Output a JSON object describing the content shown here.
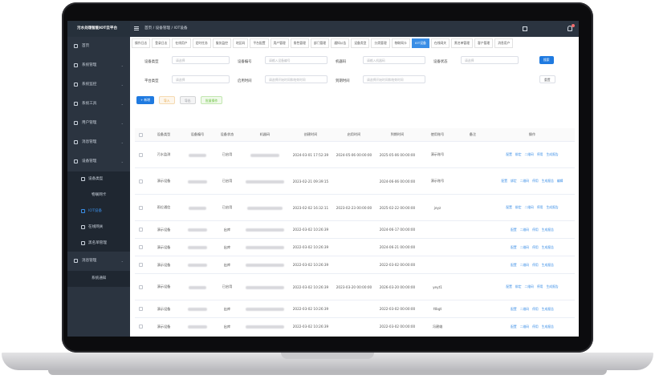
{
  "app": {
    "title": "污水处理智能IOT云平台"
  },
  "sidebar": {
    "items": [
      {
        "label": "首页",
        "icon": "home-icon",
        "type": "top"
      },
      {
        "label": "系统管理",
        "icon": "gear-icon",
        "type": "top"
      },
      {
        "label": "系统监控",
        "icon": "monitor-icon",
        "type": "top"
      },
      {
        "label": "系统工具",
        "icon": "tool-icon",
        "type": "top"
      },
      {
        "label": "用户管理",
        "icon": "user-icon",
        "type": "top"
      },
      {
        "label": "消息管理",
        "icon": "message-icon",
        "type": "top"
      },
      {
        "label": "设备管理",
        "icon": "device-icon",
        "type": "top"
      },
      {
        "label": "设备类型",
        "icon": "device-type-icon",
        "type": "sub"
      },
      {
        "label": "物联网卡",
        "icon": "",
        "type": "plain"
      },
      {
        "label": "IOT设备",
        "icon": "iot-icon",
        "type": "sub",
        "active": true
      },
      {
        "label": "在线网关",
        "icon": "gateway-icon",
        "type": "sub"
      },
      {
        "label": "黑名单管理",
        "icon": "blacklist-icon",
        "type": "sub"
      },
      {
        "label": "消息管理",
        "icon": "message-icon",
        "type": "top"
      },
      {
        "label": "系统通知",
        "icon": "",
        "type": "plain"
      }
    ]
  },
  "topbar": {
    "breadcrumb": "首页  /  设备管理  /  IOT设备"
  },
  "tabs": [
    "操作日志",
    "登录日志",
    "在线用户",
    "定时任务",
    "服务监控",
    "地区码",
    "平台配置",
    "用户管理",
    "角色管理",
    "部门管理",
    "通知公告",
    "设备类型",
    "分类管理",
    "物联网卡",
    "IOT设备",
    "在线网关",
    "黑名单管理",
    "客户管理",
    "消息用户"
  ],
  "active_tab": "IOT设备",
  "filters": {
    "device_type_label": "设备类型",
    "device_type_placeholder": "请选择",
    "device_no_label": "设备编号",
    "device_no_placeholder": "请输入设备编号",
    "machine_code_label": "机器码",
    "machine_code_placeholder": "请输入机器码",
    "device_status_label": "设备状态",
    "device_status_placeholder": "请选择",
    "platform_type_label": "平台类型",
    "platform_type_placeholder": "请选择",
    "enable_time_label": "启用时间",
    "enable_time_placeholder": "请选择开始时间和结束时间",
    "expire_time_label": "到期时间",
    "expire_time_placeholder": "请选择开始时间和结束时间"
  },
  "buttons": {
    "search": "搜索",
    "reset": "重置",
    "add": "+ 新增",
    "import": "导入",
    "export": "导出",
    "batch": "批量操作"
  },
  "table": {
    "headers": [
      "设备类型",
      "设备编号",
      "设备状态",
      "机器码",
      "创建时间",
      "启用时间",
      "到期时间",
      "使用账号",
      "备注",
      "操作"
    ],
    "rows": [
      {
        "type": "污水监测",
        "status": "已启用",
        "created": "2024-03-01 17:52:39",
        "enabled": "2024-05-06 00:00:00",
        "expire": "2025-05-06 00:00:00",
        "account": "演示账号",
        "note": "",
        "ops": [
          "配置",
          "绑定",
          "二维码",
          "停用",
          "生成报告"
        ]
      },
      {
        "type": "演示设备",
        "status": "已启用",
        "created": "2023-02-21 09:39:15",
        "enabled": "",
        "expire": "2024-06-06 00:00:00",
        "account": "演示账号",
        "note": "",
        "ops": [
          "配置",
          "绑定",
          "二维码",
          "停用",
          "生成报告",
          "编辑"
        ]
      },
      {
        "type": "雨位通信",
        "status": "已启用",
        "created": "2023-02-02 16:32:11",
        "enabled": "2023-02-23 00:00:00",
        "expire": "2025-02-22 00:00:00",
        "account": "jeyz",
        "note": "",
        "ops": [
          "配置",
          "绑定",
          "二维码",
          "停用",
          "生成报告"
        ]
      },
      {
        "type": "演示设备",
        "status": "出库",
        "created": "2022-03-02 10:26:39",
        "enabled": "",
        "expire": "2024-06-17 00:00:00",
        "account": "",
        "note": "",
        "ops": [
          "配置",
          "二维码",
          "停用",
          "生成报告"
        ]
      },
      {
        "type": "演示设备",
        "status": "出库",
        "created": "2022-03-02 10:26:39",
        "enabled": "",
        "expire": "2024-06-21 00:00:00",
        "account": "",
        "note": "",
        "ops": [
          "配置",
          "二维码",
          "停用",
          "生成报告"
        ]
      },
      {
        "type": "演示设备",
        "status": "出库",
        "created": "2022-03-02 10:26:39",
        "enabled": "",
        "expire": "2022-03-02 00:00:00",
        "account": "",
        "note": "",
        "ops": [
          "配置",
          "二维码",
          "停用",
          "生成报告"
        ]
      },
      {
        "type": "演示设备",
        "status": "已启用",
        "created": "2022-03-02 10:26:39",
        "enabled": "2023-03-20 00:00:00",
        "expire": "2026-03-20 00:00:00",
        "account": "yeyt1",
        "note": "",
        "ops": [
          "配置",
          "绑定",
          "二维码",
          "停用",
          "生成报告"
        ]
      },
      {
        "type": "演示设备",
        "status": "出库",
        "created": "2022-03-02 10:26:39",
        "enabled": "",
        "expire": "2022-03-02 00:00:00",
        "account": "ttbgt",
        "note": "",
        "ops": [
          "配置",
          "二维码",
          "停用",
          "生成报告"
        ]
      },
      {
        "type": "演示设备",
        "status": "出库",
        "created": "2022-03-02 10:26:39",
        "enabled": "",
        "expire": "2022-03-02 00:00:00",
        "account": "冯建雄",
        "note": "",
        "ops": [
          "配置",
          "二维码",
          "停用",
          "生成报告"
        ]
      },
      {
        "type": "演示设备",
        "status": "出库",
        "created": "2022-03-02 10:26:39",
        "enabled": "",
        "expire": "2022-03-02 00:00:00",
        "account": "孟逸明",
        "note": "",
        "ops": [
          "配置",
          "二维码",
          "停用",
          "生成报告"
        ]
      }
    ]
  }
}
